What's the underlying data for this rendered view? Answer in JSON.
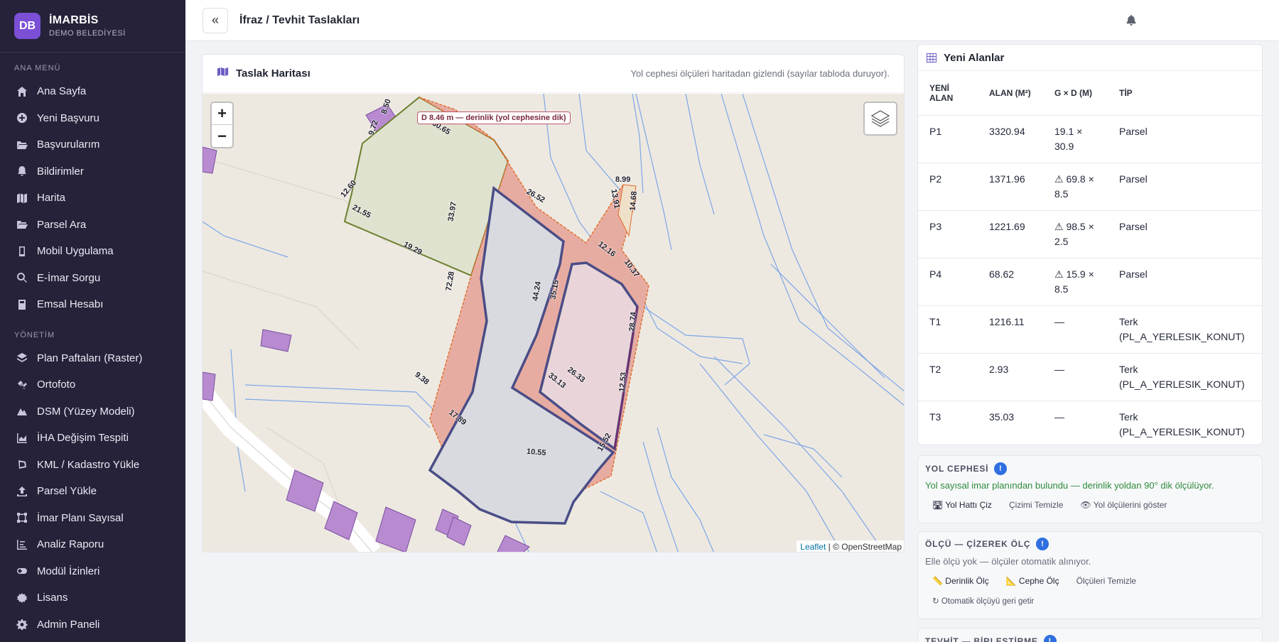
{
  "brand": {
    "initials": "DB",
    "name": "İMARBİS",
    "subtitle": "DEMO BELEDİYESİ"
  },
  "sidebar": {
    "main_label": "ANA MENÜ",
    "main_items": [
      {
        "label": "Ana Sayfa",
        "icon": "home-icon"
      },
      {
        "label": "Yeni Başvuru",
        "icon": "plus-circle-icon"
      },
      {
        "label": "Başvurularım",
        "icon": "folder-open-icon"
      },
      {
        "label": "Bildirimler",
        "icon": "bell-icon"
      },
      {
        "label": "Harita",
        "icon": "map-icon"
      },
      {
        "label": "Parsel Ara",
        "icon": "folder-open-icon"
      },
      {
        "label": "Mobil Uygulama",
        "icon": "mobile-icon"
      },
      {
        "label": "E-İmar Sorgu",
        "icon": "search-icon"
      },
      {
        "label": "Emsal Hesabı",
        "icon": "calculator-icon"
      }
    ],
    "admin_label": "YÖNETİM",
    "admin_items": [
      {
        "label": "Plan Paftaları (Raster)",
        "icon": "layers-icon"
      },
      {
        "label": "Ortofoto",
        "icon": "satellite-icon"
      },
      {
        "label": "DSM (Yüzey Modeli)",
        "icon": "mountain-icon"
      },
      {
        "label": "İHA Değişim Tespiti",
        "icon": "area-chart-icon"
      },
      {
        "label": "KML / Kadastro Yükle",
        "icon": "draw-polygon-icon"
      },
      {
        "label": "Parsel Yükle",
        "icon": "upload-icon"
      },
      {
        "label": "İmar Planı Sayısal",
        "icon": "vector-square-icon"
      },
      {
        "label": "Analiz Raporu",
        "icon": "chart-line-icon"
      },
      {
        "label": "Modül İzinleri",
        "icon": "toggle-icon"
      },
      {
        "label": "Lisans",
        "icon": "certificate-icon"
      },
      {
        "label": "Admin Paneli",
        "icon": "cog-icon"
      }
    ]
  },
  "header": {
    "collapse_label": "«",
    "title": "İfraz / Tevhit Taslakları"
  },
  "map": {
    "title": "Taslak Haritası",
    "note": "Yol cephesi ölçüleri haritadan gizlendi (sayılar tabloda duruyor).",
    "zoom_in": "+",
    "zoom_out": "−",
    "tooltip": "D 8.46 m — derinlik (yol cephesine dik)",
    "attribution_link": "Leaflet",
    "attribution_text": "| © OpenStreetMap",
    "labels": [
      "8.50",
      "30.65",
      "9.72",
      "12.60",
      "21.55",
      "19.29",
      "33.97",
      "26.52",
      "72.28",
      "8.99",
      "13.91",
      "14.68",
      "12.16",
      "10.37",
      "44.24",
      "35.15",
      "28.74",
      "26.33",
      "33.13",
      "12.53",
      "9.38",
      "17.89",
      "10.55",
      "15.52"
    ]
  },
  "table": {
    "title": "Yeni Alanlar",
    "headers": [
      "YENİ ALAN",
      "ALAN (M²)",
      "G × D (M)",
      "TİP"
    ],
    "rows": [
      {
        "id": "P1",
        "area": "3320.94",
        "gd": "19.1 × 30.9",
        "type": "Parsel"
      },
      {
        "id": "P2",
        "area": "1371.96",
        "gd": "⚠ 69.8 × 8.5",
        "type": "Parsel"
      },
      {
        "id": "P3",
        "area": "1221.69",
        "gd": "⚠ 98.5 × 2.5",
        "type": "Parsel"
      },
      {
        "id": "P4",
        "area": "68.62",
        "gd": "⚠ 15.9 × 8.5",
        "type": "Parsel"
      },
      {
        "id": "T1",
        "area": "1216.11",
        "gd": "—",
        "type": "Terk (PL_A_YERLESIK_KONUT)"
      },
      {
        "id": "T2",
        "area": "2.93",
        "gd": "—",
        "type": "Terk (PL_A_YERLESIK_KONUT)"
      },
      {
        "id": "T3",
        "area": "35.03",
        "gd": "—",
        "type": "Terk (PL_A_YERLESIK_KONUT)"
      }
    ]
  },
  "road": {
    "title": "YOL CEPHESİ",
    "info": "!",
    "status": "Yol sayısal imar planından bulundu — derinlik yoldan 90° dik ölçülüyor.",
    "btn_draw": "🛣 Yol Hattı Çiz",
    "btn_clear": "Çizimi Temizle",
    "btn_show": "👁 Yol ölçülerini göster"
  },
  "measure": {
    "title": "ÖLÇÜ — ÇİZEREK ÖLÇ",
    "info": "!",
    "status": "Elle ölçü yok — ölçüler otomatik alınıyor.",
    "btn_depth": "📏 Derinlik Ölç",
    "btn_front": "📐 Cephe Ölç",
    "btn_clear": "Ölçüleri Temizle",
    "btn_restore": "↻ Otomatik ölçüyü geri getir"
  },
  "merge": {
    "title": "TEVHİT — BİRLEŞTİRME",
    "info": "!"
  }
}
